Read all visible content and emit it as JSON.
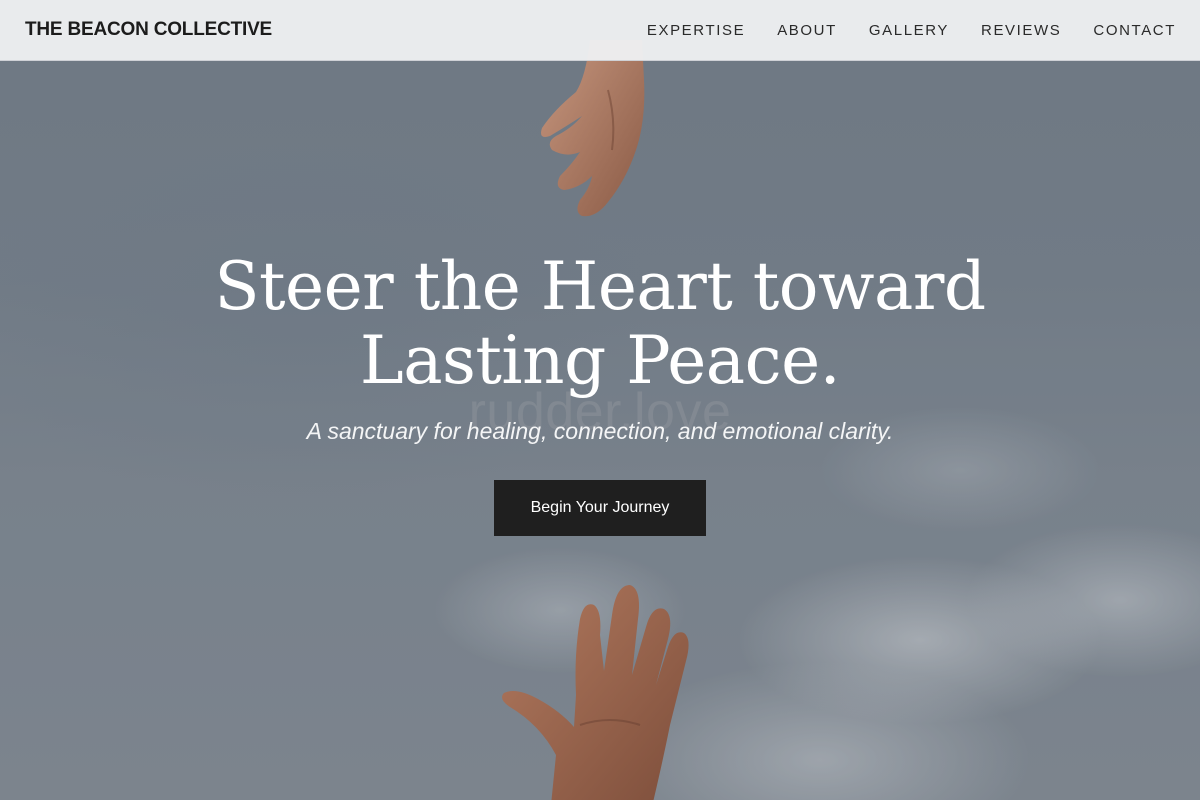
{
  "header": {
    "brand": "THE BEACON COLLECTIVE",
    "nav": [
      {
        "label": "EXPERTISE"
      },
      {
        "label": "ABOUT"
      },
      {
        "label": "GALLERY"
      },
      {
        "label": "REVIEWS"
      },
      {
        "label": "CONTACT"
      }
    ]
  },
  "hero": {
    "title": "Steer the Heart toward Lasting Peace.",
    "watermark": "rudder.love",
    "subtitle": "A sanctuary for healing, connection, and emotional clarity.",
    "cta_label": "Begin Your Journey"
  },
  "colors": {
    "header_bg": "#eeeff1",
    "button_bg": "#1f1f1f",
    "hero_text": "#ffffff"
  }
}
